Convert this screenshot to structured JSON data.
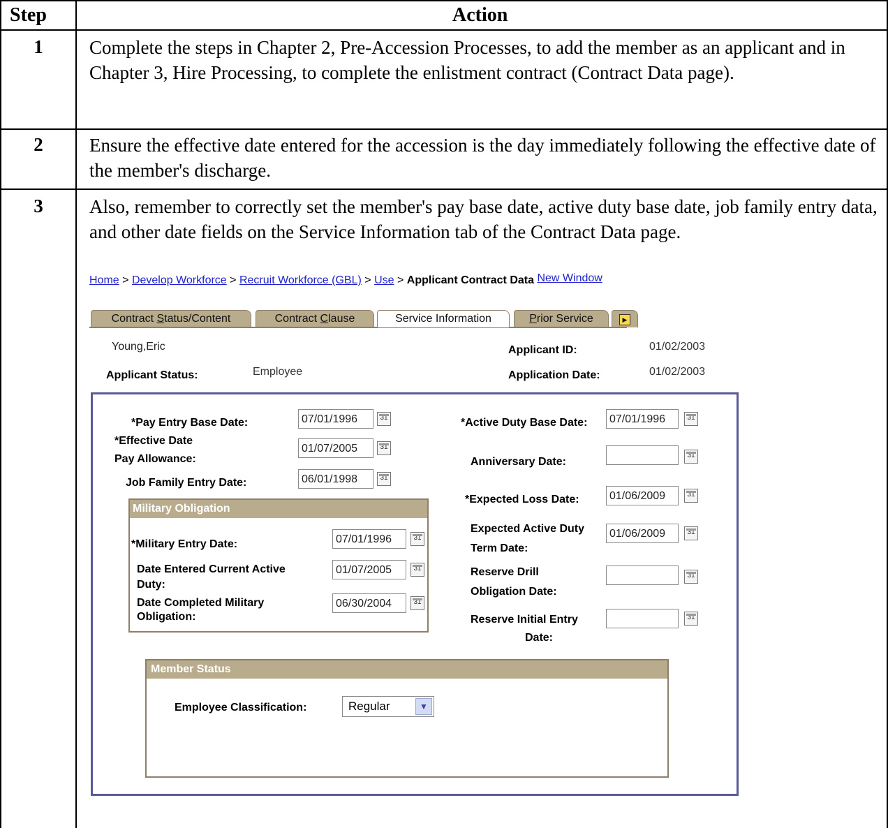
{
  "table": {
    "header_step": "Step",
    "header_action": "Action",
    "steps": [
      {
        "num": "1",
        "text": "Complete the steps in Chapter 2, Pre-Accession Processes, to add the member as an applicant and in Chapter 3, Hire Processing, to complete the enlistment contract (Contract Data page)."
      },
      {
        "num": "2",
        "text": "Ensure the effective date entered for the accession is the day immediately following the effective date of the member's discharge."
      },
      {
        "num": "3",
        "text": "Also, remember to correctly set the member's pay base date, active duty base date, job family entry data, and other date fields on the Service Information tab of the Contract Data page."
      }
    ]
  },
  "breadcrumb": {
    "home": "Home",
    "sep": ">",
    "develop": "Develop Workforce",
    "recruit": "Recruit Workforce (GBL)",
    "use": "Use",
    "current": "Applicant Contract Data",
    "new_window": "New Window"
  },
  "tabs": {
    "t1_pre": "Contract ",
    "t1_u": "S",
    "t1_post": "tatus/Content",
    "t2_pre": "Contract ",
    "t2_u": "C",
    "t2_post": "lause",
    "t3": "Service Information",
    "t4_u": "P",
    "t4_post": "rior Service"
  },
  "header": {
    "name": "Young,Eric",
    "applicant_id_label": "Applicant ID:",
    "applicant_id": "01/02/2003",
    "status_label": "Applicant Status:",
    "status": "Employee",
    "app_date_label": "Application Date:",
    "app_date": "01/02/2003"
  },
  "form": {
    "pay_entry_label": "*Pay Entry Base Date:",
    "pay_entry": "07/01/1996",
    "effective_label_1": "*Effective Date",
    "effective_label_2": "Pay Allowance:",
    "effective": "01/07/2005",
    "job_family_label": "Job Family Entry Date:",
    "job_family": "06/01/1998",
    "active_duty_label": "*Active Duty Base Date:",
    "active_duty": "07/01/1996",
    "anniversary_label": "Anniversary Date:",
    "anniversary": "",
    "expected_loss_label": "*Expected Loss Date:",
    "expected_loss": "01/06/2009",
    "expected_ad_term_label_1": "Expected Active Duty",
    "expected_ad_term_label_2": "Term Date:",
    "expected_ad_term": "01/06/2009",
    "reserve_drill_label_1": "Reserve Drill",
    "reserve_drill_label_2": "Obligation Date:",
    "reserve_drill": "",
    "reserve_initial_label_1": "Reserve Initial Entry",
    "reserve_initial_label_2": "Date:",
    "reserve_initial": ""
  },
  "military_obligation": {
    "title": "Military Obligation",
    "entry_label": "*Military Entry Date:",
    "entry": "07/01/1996",
    "current_ad_label_1": "Date Entered Current Active",
    "current_ad_label_2": "Duty:",
    "current_ad": "01/07/2005",
    "completed_label_1": "Date Completed Military",
    "completed_label_2": "Obligation:",
    "completed": "06/30/2004"
  },
  "member_status": {
    "title": "Member Status",
    "classification_label": "Employee Classification:",
    "classification": "Regular"
  },
  "icons": {
    "calendar": "calendar-icon",
    "calendar_text": "31",
    "next_tab_glyph": "▶",
    "dropdown_glyph": "▼"
  },
  "colors": {
    "tab_bg": "#b8ac8c",
    "group_header": "#b8ac8c",
    "panel_border": "#5a5a9a",
    "link": "#2222cc"
  }
}
